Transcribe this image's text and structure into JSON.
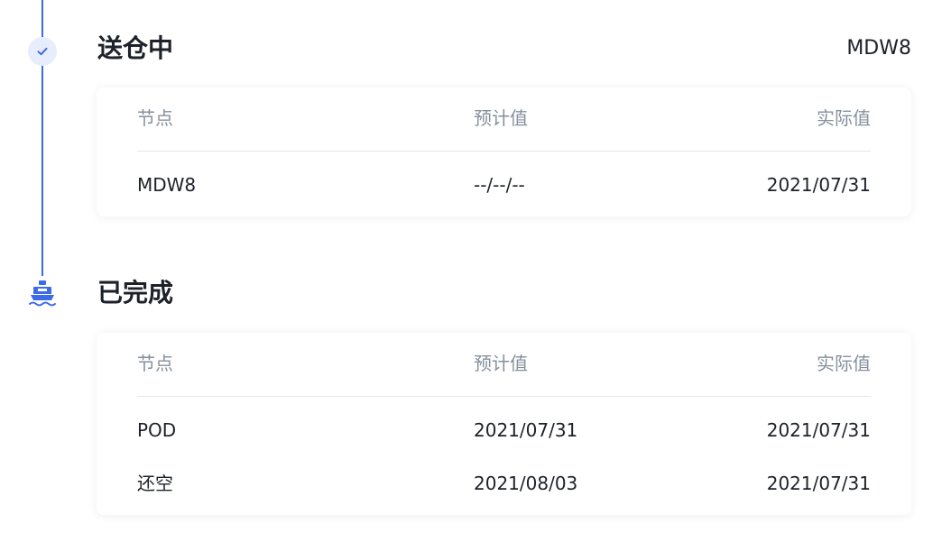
{
  "colors": {
    "accent": "#3d6ae6",
    "accent_light": "#e7edfc",
    "text_primary": "#1d2129",
    "text_secondary": "#86909c",
    "divider": "#e5e6eb"
  },
  "icons": [
    "check-icon",
    "ship-icon"
  ],
  "stages": [
    {
      "title": "送仓中",
      "location": "MDW8",
      "status_icon": "check-icon",
      "columns": [
        "节点",
        "预计值",
        "实际值"
      ],
      "rows": [
        {
          "node": "MDW8",
          "expected": "--/--/--",
          "actual": "2021/07/31"
        }
      ]
    },
    {
      "title": "已完成",
      "status_icon": "ship-icon",
      "columns": [
        "节点",
        "预计值",
        "实际值"
      ],
      "rows": [
        {
          "node": "POD",
          "expected": "2021/07/31",
          "actual": "2021/07/31"
        },
        {
          "node": "还空",
          "expected": "2021/08/03",
          "actual": "2021/07/31"
        }
      ]
    }
  ]
}
